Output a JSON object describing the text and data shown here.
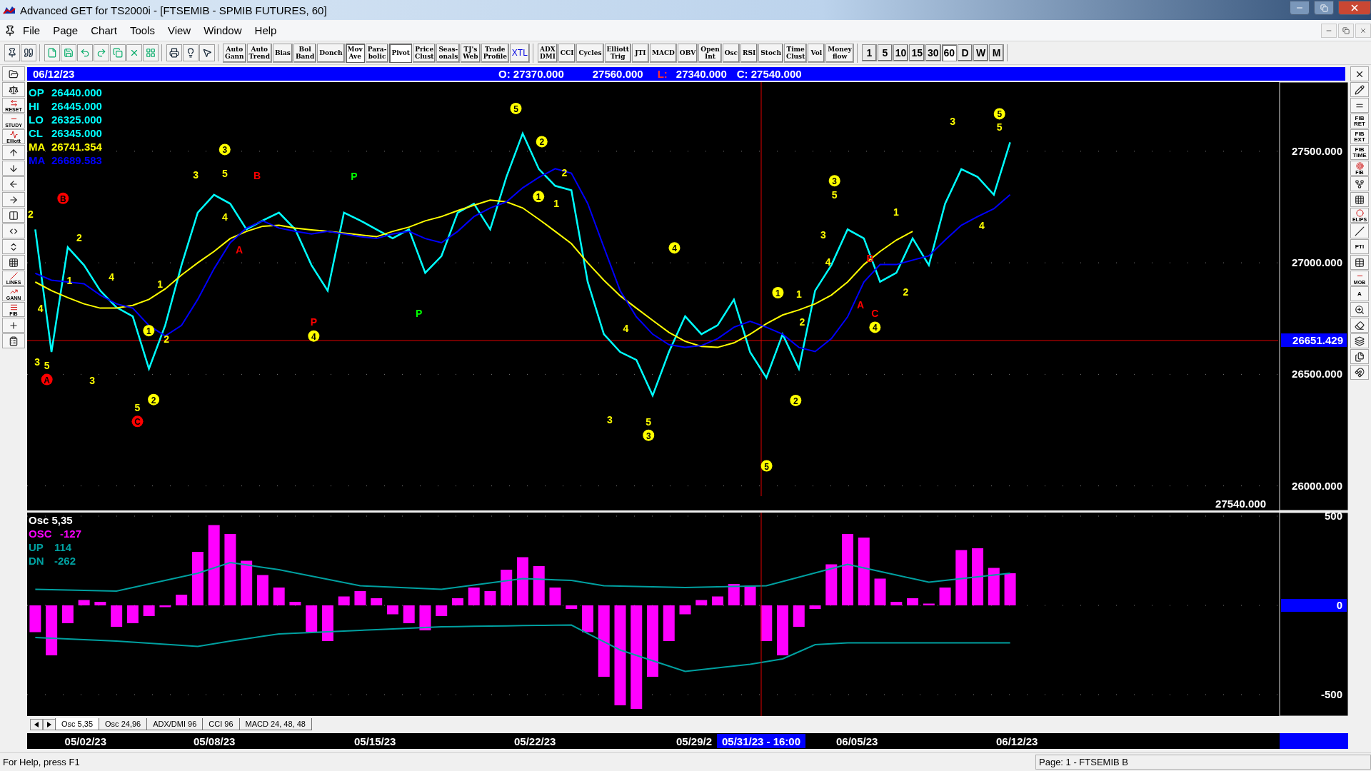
{
  "window": {
    "title": "Advanced GET for TS2000i - [FTSEMIB - SPMIB FUTURES, 60]"
  },
  "menu": [
    "File",
    "Page",
    "Chart",
    "Tools",
    "View",
    "Window",
    "Help"
  ],
  "toolbar": {
    "studies": [
      {
        "label": "Auto\nGann",
        "pressed": false
      },
      {
        "label": "Auto\nTrend",
        "pressed": false
      },
      {
        "label": "Bias",
        "pressed": false
      },
      {
        "label": "Bol\nBand",
        "pressed": false
      },
      {
        "label": "Donch",
        "pressed": false
      },
      {
        "label": "Mov\nAve",
        "pressed": true
      },
      {
        "label": "Para-\nbolic",
        "pressed": false
      },
      {
        "label": "Pivot",
        "pressed": true
      },
      {
        "label": "Price\nClust",
        "pressed": false
      },
      {
        "label": "Seas-\nonals",
        "pressed": false
      },
      {
        "label": "TJ's\nWeb",
        "pressed": false
      },
      {
        "label": "Trade\nProfile",
        "pressed": false
      },
      {
        "label": "XTL",
        "pressed": false
      }
    ],
    "indicators": [
      {
        "label": "ADX\nDMI",
        "pressed": false
      },
      {
        "label": "CCI",
        "pressed": false
      },
      {
        "label": "Cycles",
        "pressed": false
      },
      {
        "label": "Elliott\nTrig",
        "pressed": false
      },
      {
        "label": "JTI",
        "pressed": false
      },
      {
        "label": "MACD",
        "pressed": false
      },
      {
        "label": "OBV",
        "pressed": false
      },
      {
        "label": "Open\nInt",
        "pressed": false
      },
      {
        "label": "Osc",
        "pressed": false
      },
      {
        "label": "RSI",
        "pressed": false
      },
      {
        "label": "Stoch",
        "pressed": false
      },
      {
        "label": "Time\nClust",
        "pressed": false
      },
      {
        "label": "Vol",
        "pressed": false
      },
      {
        "label": "Money\nflow",
        "pressed": false
      }
    ],
    "intervals": [
      {
        "label": "1",
        "selected": false
      },
      {
        "label": "5",
        "selected": false
      },
      {
        "label": "10",
        "selected": false
      },
      {
        "label": "15",
        "selected": false
      },
      {
        "label": "30",
        "selected": false
      },
      {
        "label": "60",
        "selected": true
      },
      {
        "label": "D",
        "selected": false
      },
      {
        "label": "W",
        "selected": false
      },
      {
        "label": "M",
        "selected": false
      }
    ]
  },
  "left_toolbar": [
    {
      "kind": "icon"
    },
    {
      "kind": "icon"
    },
    {
      "kind": "labeled",
      "label": "RESET"
    },
    {
      "kind": "labeled",
      "label": "STUDY"
    },
    {
      "kind": "labeled",
      "label": "Elliott"
    },
    {
      "kind": "icon"
    },
    {
      "kind": "icon"
    },
    {
      "kind": "icon"
    },
    {
      "kind": "icon"
    },
    {
      "kind": "icon"
    },
    {
      "kind": "icon"
    },
    {
      "kind": "icon"
    },
    {
      "kind": "icon"
    },
    {
      "kind": "labeled",
      "label": "LINES"
    },
    {
      "kind": "labeled",
      "label": "GANN"
    },
    {
      "kind": "labeled",
      "label": "FIB"
    },
    {
      "kind": "icon"
    },
    {
      "kind": "icon"
    }
  ],
  "right_toolbar": [
    {
      "kind": "icon"
    },
    {
      "kind": "icon"
    },
    {
      "kind": "icon"
    },
    {
      "kind": "text",
      "label": "FIB\nRET"
    },
    {
      "kind": "text",
      "label": "FIB\nEXT"
    },
    {
      "kind": "text",
      "label": "FIB\nTIME"
    },
    {
      "kind": "labeled",
      "label": "FIB"
    },
    {
      "kind": "icon"
    },
    {
      "kind": "icon"
    },
    {
      "kind": "labeled",
      "label": "ELIPS"
    },
    {
      "kind": "icon"
    },
    {
      "kind": "text",
      "label": "PTI"
    },
    {
      "kind": "icon"
    },
    {
      "kind": "labeled",
      "label": "MOB"
    },
    {
      "kind": "text",
      "label": "A"
    },
    {
      "kind": "icon"
    },
    {
      "kind": "icon"
    },
    {
      "kind": "icon"
    },
    {
      "kind": "icon"
    },
    {
      "kind": "icon"
    }
  ],
  "header": {
    "date": "06/12/23",
    "open": "O: 27370.000",
    "high": "27560.000",
    "low_label": "L:",
    "low": "27340.000",
    "close": "C: 27540.000"
  },
  "legend": [
    {
      "label": "OP",
      "value": "26440.000"
    },
    {
      "label": "HI",
      "value": "26445.000"
    },
    {
      "label": "LO",
      "value": "26325.000"
    },
    {
      "label": "CL",
      "value": "26345.000"
    }
  ],
  "ma_values": [
    "26741.354",
    "26689.583"
  ],
  "cursor": {
    "time": "05/31/23 - 16:00"
  },
  "last_close_label": "27540.000",
  "price_chart": {
    "chart_data": {
      "type": "line",
      "ylim": [
        25890,
        27810
      ],
      "grid": true,
      "series": [
        {
          "color": "#00ffff",
          "values": [
            27150,
            26600,
            27070,
            26990,
            26875,
            26800,
            26760,
            26525,
            26720,
            26990,
            27225,
            27305,
            27265,
            27150,
            27190,
            27225,
            27150,
            26990,
            26875,
            27225,
            27190,
            27150,
            27110,
            27150,
            26955,
            27030,
            27225,
            27265,
            27150,
            27385,
            27580,
            27420,
            27345,
            27325,
            26915,
            26680,
            26600,
            26565,
            26405,
            26600,
            26760,
            26680,
            26720,
            26835,
            26600,
            26485,
            26680,
            26525,
            26875,
            26990,
            27150,
            27110,
            26915,
            26955,
            27110,
            26990,
            27265,
            27420,
            27385,
            27305,
            27540,
            null,
            null,
            null,
            null,
            null,
            null,
            null,
            null,
            null,
            null,
            null,
            null,
            null,
            null,
            null,
            null
          ]
        },
        {
          "name": "MA",
          "color": "#ffff00",
          "values": [
            26914,
            26875,
            26844,
            26816,
            26797,
            26797,
            26809,
            26836,
            26883,
            26945,
            27000,
            27051,
            27109,
            27141,
            27164,
            27168,
            27156,
            27148,
            27141,
            27133,
            27125,
            27117,
            27141,
            27160,
            27188,
            27207,
            27234,
            27258,
            27281,
            27273,
            27246,
            27195,
            27141,
            27086,
            27000,
            26922,
            26852,
            26797,
            26742,
            26688,
            26648,
            26625,
            26621,
            26641,
            26680,
            26727,
            26766,
            26789,
            26816,
            26855,
            26914,
            26992,
            27051,
            27102,
            27141,
            null,
            null,
            null,
            null,
            null,
            null,
            null,
            null,
            null,
            null,
            null,
            null,
            null,
            null,
            null,
            null,
            null,
            null,
            null,
            null,
            null,
            null
          ]
        },
        {
          "name": "MA",
          "color": "#0000ff",
          "values": [
            26953,
            26922,
            26914,
            26906,
            26855,
            26816,
            26797,
            26719,
            26672,
            26719,
            26836,
            26973,
            27090,
            27156,
            27188,
            27156,
            27141,
            27129,
            27141,
            27129,
            27117,
            27109,
            27129,
            27141,
            27109,
            27090,
            27141,
            27207,
            27246,
            27273,
            27336,
            27383,
            27422,
            27402,
            27266,
            27070,
            26875,
            26758,
            26680,
            26633,
            26621,
            26629,
            26660,
            26711,
            26738,
            26711,
            26680,
            26621,
            26602,
            26660,
            26758,
            26914,
            26992,
            26992,
            27012,
            27031,
            27102,
            27168,
            27207,
            27242,
            27305,
            null,
            null,
            null,
            null,
            null,
            null,
            null,
            null,
            null,
            null,
            null,
            null,
            null,
            null,
            null,
            null
          ]
        }
      ],
      "yticks": [
        {
          "value": 27500,
          "label": "27500.000"
        },
        {
          "value": 27000,
          "label": "27000.000"
        },
        {
          "value": 26500,
          "label": "26500.000"
        },
        {
          "value": 26000,
          "label": "26000.000"
        }
      ],
      "ref_lines": [
        {
          "axis": "y",
          "value": 26651.429,
          "label": "26651.429",
          "color": "#e00000"
        }
      ]
    },
    "wave_labels": [
      {
        "text": "2",
        "circled": false,
        "color": "#ffff00"
      },
      {
        "text": "B",
        "circled": true,
        "color": "#ff0000"
      },
      {
        "text": "2",
        "circled": false,
        "color": "#ffff00"
      },
      {
        "text": "1",
        "circled": false,
        "color": "#ffff00"
      },
      {
        "text": "4",
        "circled": false,
        "color": "#ffff00"
      },
      {
        "text": "4",
        "circled": false,
        "color": "#ffff00"
      },
      {
        "text": "3",
        "circled": false,
        "color": "#ffff00"
      },
      {
        "text": "5",
        "circled": false,
        "color": "#ffff00"
      },
      {
        "text": "A",
        "circled": true,
        "color": "#ff0000"
      },
      {
        "text": "3",
        "circled": false,
        "color": "#ffff00"
      },
      {
        "text": "1",
        "circled": true,
        "color": "#ffff00"
      },
      {
        "text": "2",
        "circled": false,
        "color": "#ffff00"
      },
      {
        "text": "1",
        "circled": false,
        "color": "#ffff00"
      },
      {
        "text": "5",
        "circled": false,
        "color": "#ffff00"
      },
      {
        "text": "2",
        "circled": true,
        "color": "#ffff00"
      },
      {
        "text": "C",
        "circled": true,
        "color": "#ff0000"
      },
      {
        "text": "3",
        "circled": false,
        "color": "#ffff00"
      },
      {
        "text": "3",
        "circled": true,
        "color": "#ffff00"
      },
      {
        "text": "5",
        "circled": false,
        "color": "#ffff00"
      },
      {
        "text": "4",
        "circled": false,
        "color": "#ffff00"
      },
      {
        "text": "B",
        "circled": false,
        "color": "#ff0000"
      },
      {
        "text": "A",
        "circled": false,
        "color": "#ff0000"
      },
      {
        "text": "P",
        "circled": false,
        "color": "#00ff00"
      },
      {
        "text": "P",
        "circled": false,
        "color": "#00ff00"
      },
      {
        "text": "P",
        "circled": false,
        "color": "#ff0000"
      },
      {
        "text": "4",
        "circled": true,
        "color": "#ffff00"
      },
      {
        "text": "5",
        "circled": true,
        "color": "#ffff00"
      },
      {
        "text": "2",
        "circled": true,
        "color": "#ffff00"
      },
      {
        "text": "2",
        "circled": false,
        "color": "#ffff00"
      },
      {
        "text": "1",
        "circled": true,
        "color": "#ffff00"
      },
      {
        "text": "1",
        "circled": false,
        "color": "#ffff00"
      },
      {
        "text": "4",
        "circled": true,
        "color": "#ffff00"
      },
      {
        "text": "4",
        "circled": false,
        "color": "#ffff00"
      },
      {
        "text": "3",
        "circled": false,
        "color": "#ffff00"
      },
      {
        "text": "5",
        "circled": false,
        "color": "#ffff00"
      },
      {
        "text": "3",
        "circled": true,
        "color": "#ffff00"
      },
      {
        "text": "5",
        "circled": true,
        "color": "#ffff00"
      },
      {
        "text": "1",
        "circled": true,
        "color": "#ffff00"
      },
      {
        "text": "1",
        "circled": false,
        "color": "#ffff00"
      },
      {
        "text": "2",
        "circled": false,
        "color": "#ffff00"
      },
      {
        "text": "2",
        "circled": true,
        "color": "#ffff00"
      },
      {
        "text": "3",
        "circled": true,
        "color": "#ffff00"
      },
      {
        "text": "5",
        "circled": false,
        "color": "#ffff00"
      },
      {
        "text": "3",
        "circled": false,
        "color": "#ffff00"
      },
      {
        "text": "4",
        "circled": false,
        "color": "#ffff00"
      },
      {
        "text": "A",
        "circled": false,
        "color": "#ff0000"
      },
      {
        "text": "B",
        "circled": false,
        "color": "#ff0000"
      },
      {
        "text": "C",
        "circled": false,
        "color": "#ff0000"
      },
      {
        "text": "4",
        "circled": true,
        "color": "#ffff00"
      },
      {
        "text": "1",
        "circled": false,
        "color": "#ffff00"
      },
      {
        "text": "2",
        "circled": false,
        "color": "#ffff00"
      },
      {
        "text": "3",
        "circled": false,
        "color": "#ffff00"
      },
      {
        "text": "5",
        "circled": true,
        "color": "#ffff00"
      },
      {
        "text": "5",
        "circled": false,
        "color": "#ffff00"
      },
      {
        "text": "4",
        "circled": false,
        "color": "#ffff00"
      }
    ]
  },
  "oscillator": {
    "title": "Osc 5,35",
    "readings": [
      "-127",
      "114",
      "-262"
    ],
    "chart_data": {
      "type": "bar",
      "ylim": [
        -620,
        520
      ],
      "grid": true,
      "series": [
        {
          "name": "OSC",
          "color": "#ff00ff",
          "values": [
            -150,
            -280,
            -100,
            30,
            20,
            -120,
            -100,
            -60,
            -10,
            60,
            300,
            450,
            400,
            250,
            170,
            100,
            20,
            -150,
            -200,
            50,
            80,
            40,
            -50,
            -100,
            -140,
            -60,
            40,
            100,
            80,
            200,
            270,
            220,
            100,
            -20,
            -150,
            -400,
            -560,
            -580,
            -400,
            -200,
            -50,
            30,
            50,
            120,
            110,
            -200,
            -280,
            -120,
            -20,
            230,
            400,
            380,
            150,
            20,
            40,
            10,
            100,
            310,
            320,
            210,
            180,
            null,
            null,
            null,
            null,
            null,
            null,
            null,
            null,
            null,
            null,
            null,
            null,
            null,
            null,
            null,
            null
          ]
        },
        {
          "name": "UP",
          "type": "line",
          "color": "#00a0a0",
          "values": [
            90,
            88,
            86,
            84,
            82,
            80,
            100,
            120,
            140,
            160,
            180,
            210,
            240,
            227,
            213,
            200,
            182,
            164,
            146,
            128,
            110,
            106,
            102,
            98,
            94,
            90,
            102,
            114,
            126,
            138,
            150,
            147,
            143,
            140,
            125,
            110,
            108,
            106,
            104,
            102,
            100,
            102,
            104,
            106,
            108,
            110,
            134,
            158,
            182,
            206,
            230,
            210,
            190,
            170,
            150,
            130,
            140,
            150,
            160,
            170,
            180,
            null,
            null,
            null,
            null,
            null,
            null,
            null,
            null,
            null,
            null,
            null,
            null,
            null,
            null,
            null,
            null
          ]
        },
        {
          "name": "DN",
          "type": "line",
          "color": "#00a0a0",
          "values": [
            -180,
            -184,
            -188,
            -192,
            -196,
            -200,
            -206,
            -212,
            -218,
            -224,
            -230,
            -215,
            -200,
            -187,
            -173,
            -160,
            -156,
            -152,
            -148,
            -144,
            -140,
            -136,
            -132,
            -128,
            -124,
            -120,
            -119,
            -117,
            -116,
            -115,
            -113,
            -112,
            -111,
            -110,
            -157,
            -203,
            -250,
            -280,
            -310,
            -340,
            -370,
            -360,
            -350,
            -340,
            -330,
            -315,
            -300,
            -260,
            -220,
            -215,
            -210,
            -210,
            -210,
            -210,
            -210,
            -210,
            -210,
            -210,
            -210,
            -210,
            -210,
            null,
            null,
            null,
            null,
            null,
            null,
            null,
            null,
            null,
            null,
            null,
            null,
            null,
            null,
            null,
            null
          ]
        }
      ],
      "yticks": [
        {
          "value": 500,
          "label": "500"
        },
        {
          "value": 0,
          "label": "0"
        },
        {
          "value": -500,
          "label": "-500"
        }
      ]
    }
  },
  "study_tabs": [
    {
      "label": "Osc 5,35",
      "selected": true
    },
    {
      "label": "Osc 24,96",
      "selected": false
    },
    {
      "label": "ADX/DMI 96",
      "selected": false
    },
    {
      "label": "CCI 96",
      "selected": false
    },
    {
      "label": "MACD 24, 48, 48",
      "selected": false
    }
  ],
  "date_axis": [
    "05/02/23",
    "05/08/23",
    "05/15/23",
    "05/22/23",
    "05/29/2",
    "06/05/23",
    "06/12/23"
  ],
  "status_bar": {
    "help": "For Help, press F1",
    "page": "Page: 1 - FTSEMIB B"
  }
}
